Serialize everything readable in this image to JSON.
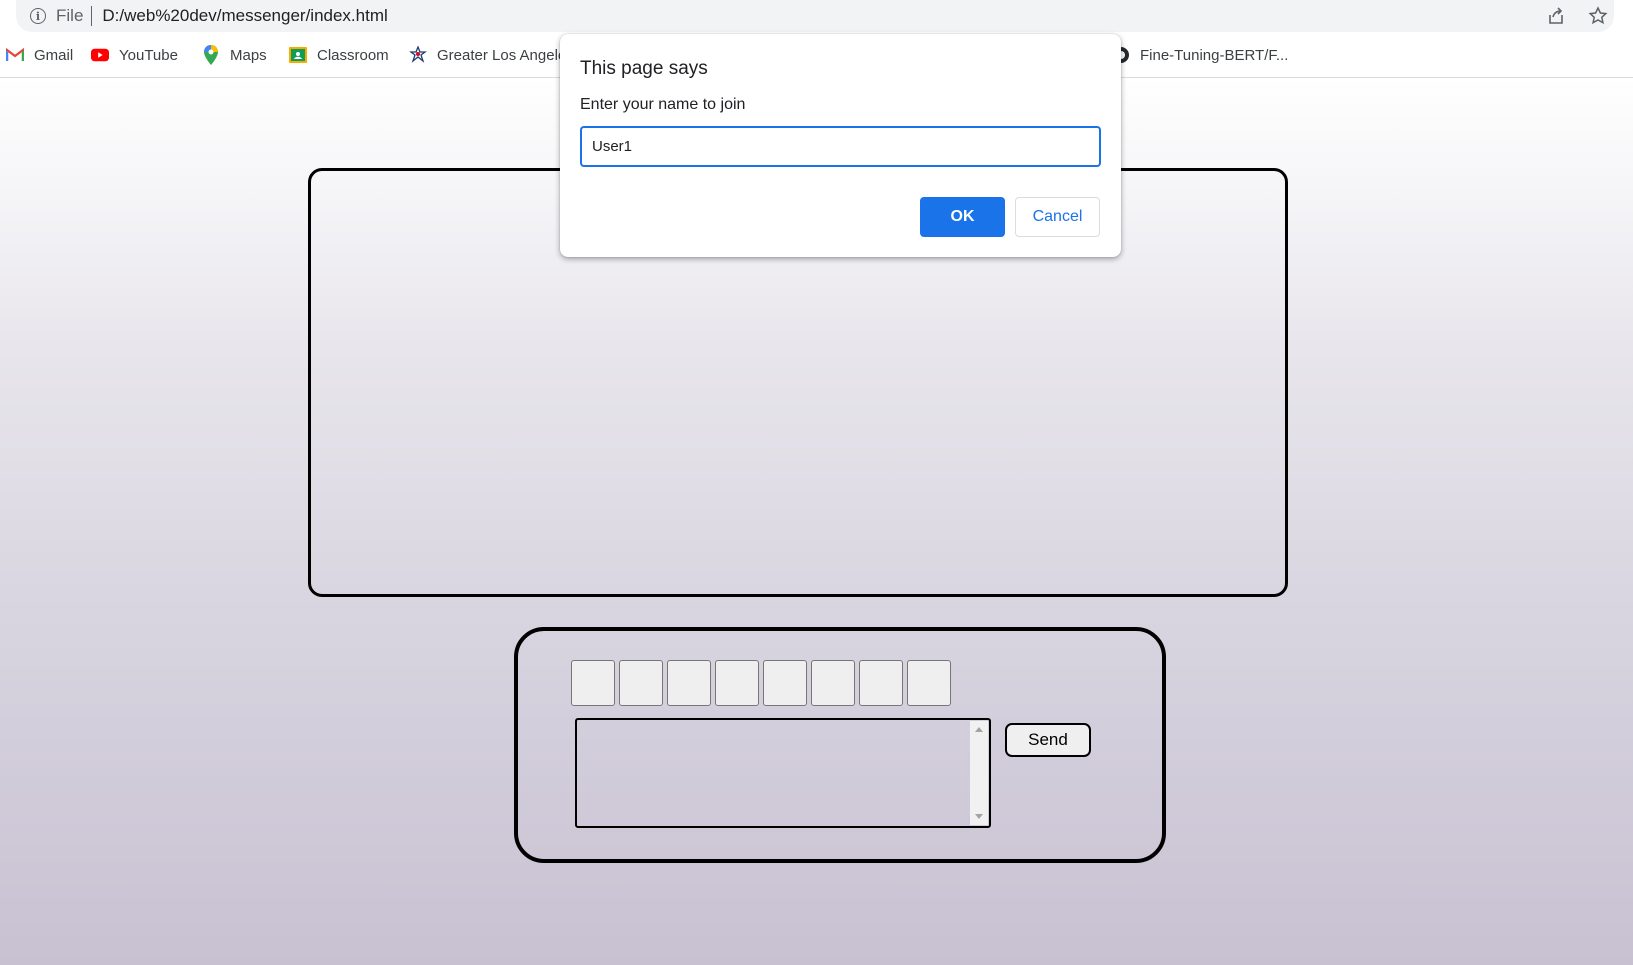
{
  "browser": {
    "scheme_label": "File",
    "url": "D:/web%20dev/messenger/index.html",
    "icons": [
      "info-icon",
      "share-icon",
      "star-icon"
    ]
  },
  "bookmarks": [
    {
      "label": "Gmail",
      "icon": "gmail-icon"
    },
    {
      "label": "YouTube",
      "icon": "youtube-icon"
    },
    {
      "label": "Maps",
      "icon": "maps-icon"
    },
    {
      "label": "Classroom",
      "icon": "classroom-icon"
    },
    {
      "label": "Greater Los Angele",
      "icon": "scouts-icon"
    },
    {
      "label": "Fine-Tuning-BERT/F...",
      "icon": "github-icon"
    }
  ],
  "dialog": {
    "title": "This page says",
    "message": "Enter your name to join",
    "input_value": "User1",
    "ok_label": "OK",
    "cancel_label": "Cancel"
  },
  "messenger": {
    "emoji_button_count": 8,
    "send_label": "Send",
    "message_value": ""
  },
  "colors": {
    "accent": "#1a73e8",
    "page_gradient_top": "#ffffff",
    "page_gradient_bottom": "#c8c1d2"
  }
}
